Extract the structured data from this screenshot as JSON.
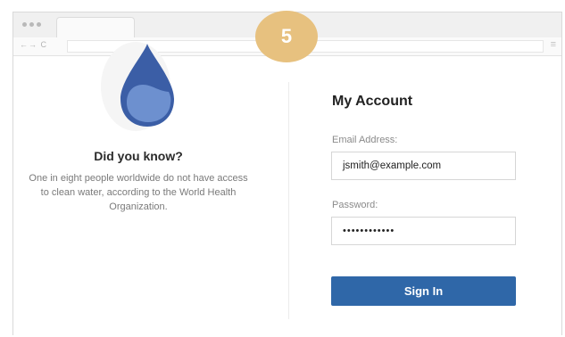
{
  "step_badge": "5",
  "info": {
    "heading": "Did you know?",
    "text": "One in eight people worldwide do not have access to clean water, according to the World Health Organization.",
    "icon": "water-drop-icon",
    "icon_color": "#3b5ea6"
  },
  "account": {
    "title": "My Account",
    "email_label": "Email Address:",
    "email_value": "jsmith@example.com",
    "password_label": "Password:",
    "password_value": "••••••••••••",
    "sign_in_label": "Sign In"
  },
  "colors": {
    "badge": "#e7c17f",
    "button": "#2f67a8"
  }
}
